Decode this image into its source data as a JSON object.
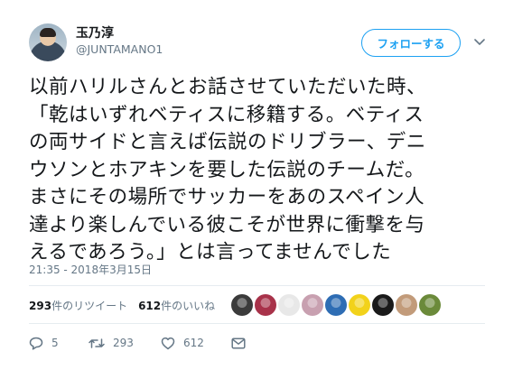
{
  "user": {
    "display_name": "玉乃淳",
    "screen_name": "@JUNTAMANO1",
    "avatar_icon": "user-avatar"
  },
  "follow_button": {
    "label": "フォローする",
    "color": "#1da1f2"
  },
  "tweet": {
    "lines": [
      "以前ハリルさんとお話させていただいた時、",
      "「乾はいずれベティスに移籍する。ベティス",
      "の両サイドと言えば伝説のドリブラー、デニ",
      "ウソンとホアキンを要した伝説のチームだ。",
      "まさにその場所でサッカーをあのスペイン人",
      "達より楽しんでいる彼こそが世界に衝撃を与",
      "えるであろう。」とは言ってませんでした"
    ],
    "timestamp": "21:35 - 2018年3月15日"
  },
  "stats": {
    "retweets_count": "293",
    "retweets_label": "件のリツイート",
    "likes_count": "612",
    "likes_label": "件のいいね"
  },
  "likers": [
    {
      "icon": "liker-avatar-1",
      "color": "#3b3b3b"
    },
    {
      "icon": "liker-avatar-2",
      "color": "#a8324a"
    },
    {
      "icon": "liker-avatar-3",
      "color": "#e8e8e8"
    },
    {
      "icon": "liker-avatar-4",
      "color": "#c8a0b0"
    },
    {
      "icon": "liker-avatar-5",
      "color": "#2e6db4"
    },
    {
      "icon": "liker-avatar-6",
      "color": "#f2d21b"
    },
    {
      "icon": "liker-avatar-7",
      "color": "#1a1a1a"
    },
    {
      "icon": "liker-avatar-8",
      "color": "#c29b7a"
    },
    {
      "icon": "liker-avatar-9",
      "color": "#6b8a3a"
    }
  ],
  "actions": {
    "reply_count": "5",
    "retweet_count": "293",
    "like_count": "612"
  },
  "colors": {
    "secondary_text": "#657786",
    "divider": "#e6ecf0"
  }
}
